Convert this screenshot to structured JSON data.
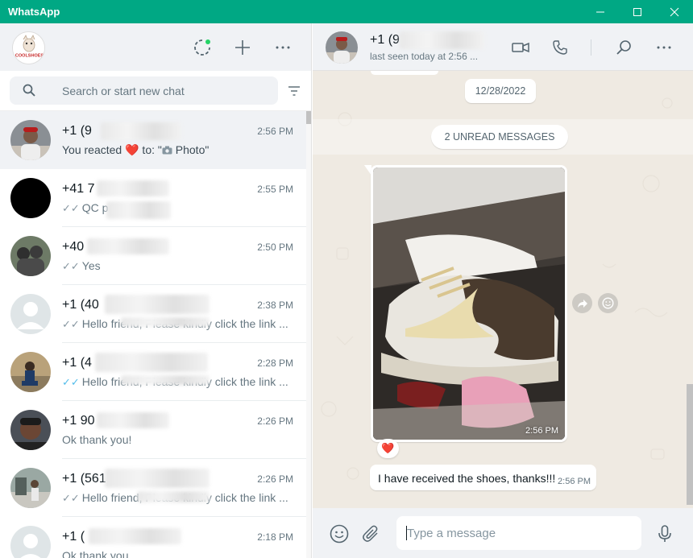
{
  "window": {
    "title": "WhatsApp",
    "controls": [
      "minimize",
      "maximize",
      "close"
    ]
  },
  "colors": {
    "titlebar": "#00a884",
    "panel_header": "#f0f2f5",
    "chat_background": "#efeae2",
    "read_tick": "#53bdeb",
    "heart": "#e53935"
  },
  "left_panel": {
    "header_icons": [
      "status-icon",
      "new-chat-icon",
      "menu-icon"
    ],
    "search": {
      "placeholder": "Search or start new chat",
      "value": ""
    },
    "chats": [
      {
        "name": "+1 (9",
        "time": "2:56 PM",
        "preview_prefix": "You reacted ",
        "preview_emoji": "❤️",
        "preview_mid": " to: \"",
        "preview_icon": "camera-icon",
        "preview_suffix": " Photo\"",
        "active": true,
        "tick": ""
      },
      {
        "name": "+41 7",
        "time": "2:55 PM",
        "preview": "QC p",
        "tick": "read-grey"
      },
      {
        "name": "+40",
        "time": "2:50 PM",
        "preview": "Yes",
        "tick": "read-grey"
      },
      {
        "name": "+1 (40",
        "time": "2:38 PM",
        "preview": "Hello friend,  Please kindly click the link ...",
        "tick": "read-grey"
      },
      {
        "name": "+1 (4",
        "time": "2:28 PM",
        "preview": "Hello friend,  Please kindly click the link ...",
        "tick": "read-blue"
      },
      {
        "name": "+1 90",
        "time": "2:26 PM",
        "preview": "Ok thank you!",
        "tick": ""
      },
      {
        "name": "+1 (561",
        "time": "2:26 PM",
        "preview": "Hello friend,  Please kindly click the link ...",
        "tick": "read-grey"
      },
      {
        "name": "+1 (",
        "time": "2:18 PM",
        "preview": "Ok thank you.",
        "tick": ""
      }
    ]
  },
  "conversation": {
    "contact_name": "+1 (9",
    "contact_status": "last seen today at 2:56 ...",
    "header_icons": [
      "video-call-icon",
      "voice-call-icon",
      "search-icon",
      "menu-icon"
    ],
    "date_chip": "12/28/2022",
    "unread_label": "2 UNREAD MESSAGES",
    "photo_message": {
      "time": "2:56 PM",
      "reaction": "❤️"
    },
    "text_message": {
      "text": "I have received the shoes, thanks!!!",
      "time": "2:56 PM"
    }
  },
  "composer": {
    "placeholder": "Type a message",
    "value": "",
    "icons": [
      "emoji-icon",
      "attach-icon",
      "microphone-icon"
    ]
  }
}
